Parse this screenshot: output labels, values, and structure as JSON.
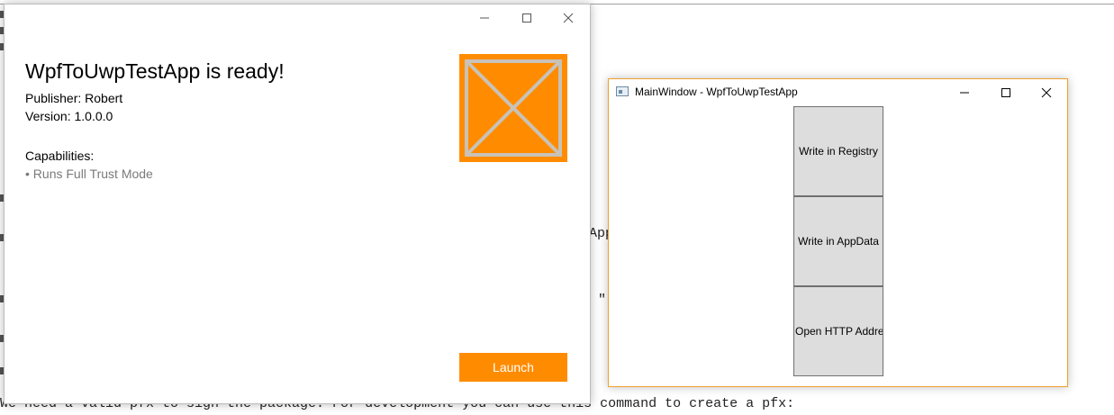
{
  "background": {
    "fragment_app": "App",
    "fragment_quote": "\"",
    "bottom_text": "We need a valid pfx to sign the package. For development you can use this command to create a pfx:"
  },
  "installer": {
    "title": "WpfToUwpTestApp is ready!",
    "publisher": "Publisher: Robert",
    "version": "Version: 1.0.0.0",
    "capabilities_label": "Capabilities:",
    "capabilities": [
      "• Runs Full Trust Mode"
    ],
    "launch_label": "Launch",
    "colors": {
      "accent": "#ff8c00",
      "muted_text": "#7a7a7a"
    }
  },
  "main_window": {
    "title": "MainWindow - WpfToUwpTestApp",
    "buttons": [
      "Write in Registry",
      "Write in AppData",
      "Open HTTP Address"
    ],
    "colors": {
      "border": "#f0a030",
      "button_bg": "#dddddd"
    }
  },
  "icons": [
    "minimize-icon",
    "maximize-icon",
    "close-icon",
    "app-logo-placeholder",
    "window-app-icon"
  ]
}
